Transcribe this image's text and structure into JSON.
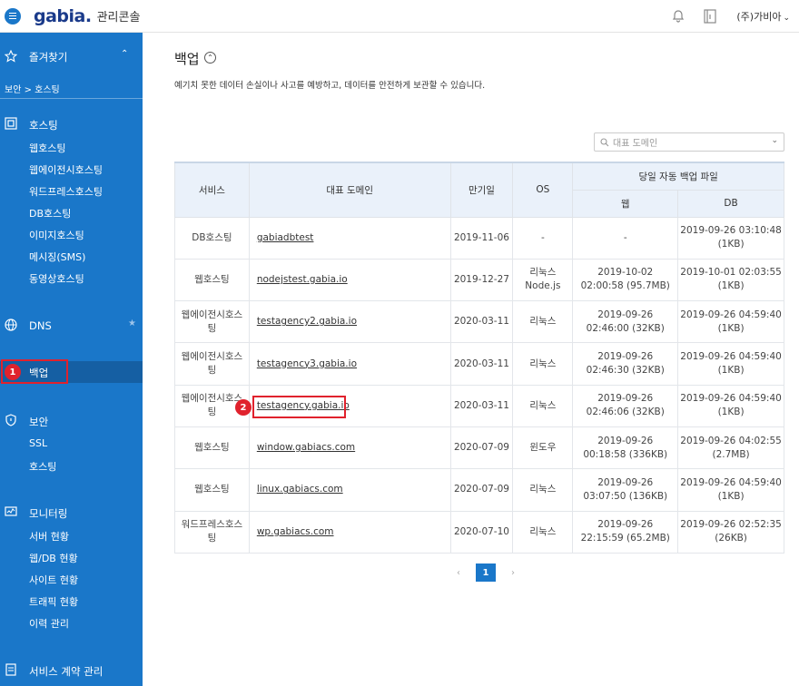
{
  "header": {
    "logo": "gabia.",
    "console_title": "관리콘솔",
    "user_label": "(주)가비아",
    "icons": [
      "menu-icon",
      "bell-icon",
      "book-icon"
    ]
  },
  "sidebar": {
    "favorites_label": "즐겨찾기",
    "breadcrumb": "보안 > 호스팅",
    "sections": [
      {
        "label": "호스팅",
        "icon": "hosting-icon",
        "items": [
          "웹호스팅",
          "웹에이전시호스팅",
          "워드프레스호스팅",
          "DB호스팅",
          "이미지호스팅",
          "메시징(SMS)",
          "동영상호스팅"
        ]
      },
      {
        "label": "DNS",
        "icon": "globe-icon",
        "items": []
      },
      {
        "label": "백업",
        "icon": "",
        "items": []
      },
      {
        "label": "보안",
        "icon": "shield-icon",
        "items": [
          "SSL",
          "호스팅"
        ]
      },
      {
        "label": "모니터링",
        "icon": "monitor-icon",
        "items": [
          "서버 현황",
          "웹/DB 현황",
          "사이트 현황",
          "트래픽 현황",
          "이력 관리"
        ]
      },
      {
        "label": "서비스 계약 관리",
        "icon": "contract-icon",
        "items": []
      }
    ],
    "step_badge": "1"
  },
  "main": {
    "title": "백업",
    "description": "예기치 못한 데이터 손실이나 사고를 예방하고, 데이터를 안전하게 보관할 수 있습니다.",
    "search_placeholder": "대표 도메인",
    "step_badge": "2",
    "table": {
      "headers": {
        "service": "서비스",
        "domain": "대표 도메인",
        "expiry": "만기일",
        "os": "OS",
        "backup_group": "당일 자동 백업 파일",
        "web": "웹",
        "db": "DB"
      },
      "rows": [
        {
          "service": "DB호스팅",
          "domain": "gabiadbtest",
          "expiry": "2019-11-06",
          "os": "-",
          "web": "-",
          "db": "2019-09-26 03:10:48 (1KB)"
        },
        {
          "service": "웹호스팅",
          "domain": "nodejstest.gabia.io",
          "expiry": "2019-12-27",
          "os": "리눅스 Node.js",
          "web": "2019-10-02 02:00:58 (95.7MB)",
          "db": "2019-10-01 02:03:55 (1KB)"
        },
        {
          "service": "웹에이전시호스팅",
          "domain": "testagency2.gabia.io",
          "expiry": "2020-03-11",
          "os": "리눅스",
          "web": "2019-09-26 02:46:00 (32KB)",
          "db": "2019-09-26 04:59:40 (1KB)"
        },
        {
          "service": "웹에이전시호스팅",
          "domain": "testagency3.gabia.io",
          "expiry": "2020-03-11",
          "os": "리눅스",
          "web": "2019-09-26 02:46:30 (32KB)",
          "db": "2019-09-26 04:59:40 (1KB)"
        },
        {
          "service": "웹에이전시호스팅",
          "domain": "testagency.gabia.io",
          "expiry": "2020-03-11",
          "os": "리눅스",
          "web": "2019-09-26 02:46:06 (32KB)",
          "db": "2019-09-26 04:59:40 (1KB)"
        },
        {
          "service": "웹호스팅",
          "domain": "window.gabiacs.com",
          "expiry": "2020-07-09",
          "os": "윈도우",
          "web": "2019-09-26 00:18:58 (336KB)",
          "db": "2019-09-26 04:02:55 (2.7MB)"
        },
        {
          "service": "웹호스팅",
          "domain": "linux.gabiacs.com",
          "expiry": "2020-07-09",
          "os": "리눅스",
          "web": "2019-09-26 03:07:50 (136KB)",
          "db": "2019-09-26 04:59:40 (1KB)"
        },
        {
          "service": "워드프레스호스팅",
          "domain": "wp.gabiacs.com",
          "expiry": "2020-07-10",
          "os": "리눅스",
          "web": "2019-09-26 22:15:59 (65.2MB)",
          "db": "2019-09-26 02:52:35 (26KB)"
        }
      ]
    },
    "pagination": {
      "prev": "‹",
      "current": "1",
      "next": "›"
    }
  }
}
